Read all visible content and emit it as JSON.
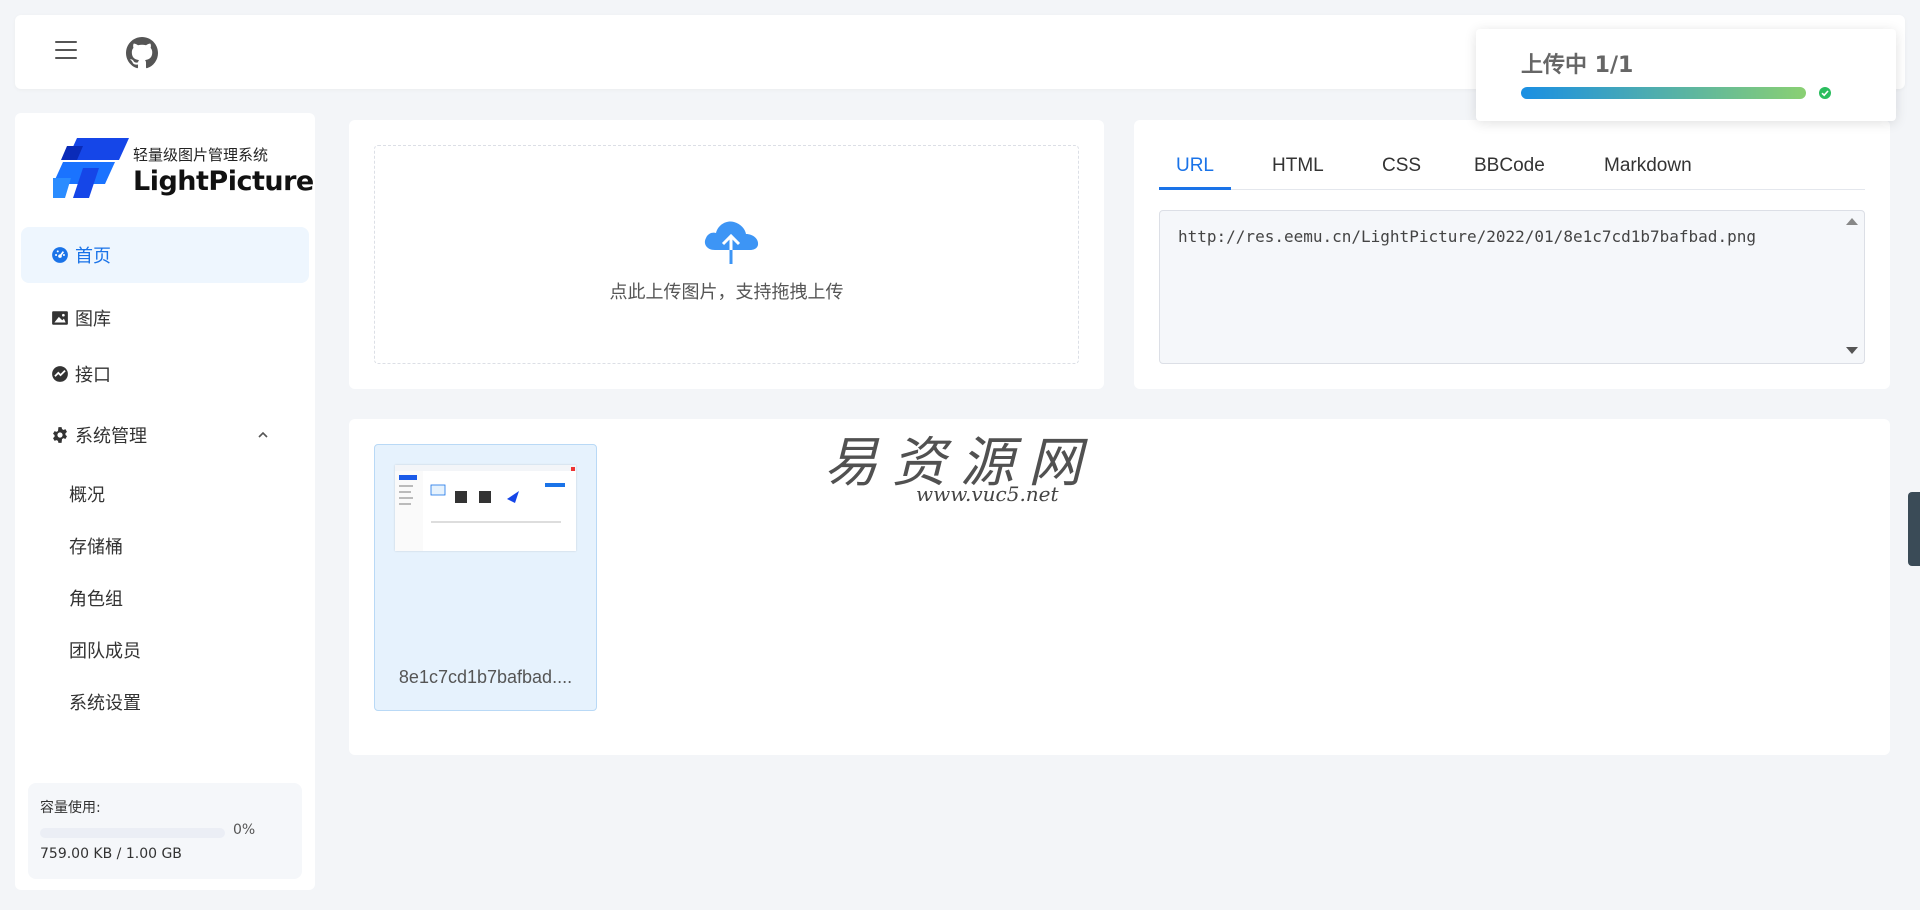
{
  "header": {
    "menu_icon": "hamburger-menu-icon",
    "github_icon": "github-icon"
  },
  "sidebar": {
    "logo": {
      "subtitle": "轻量级图片管理系统",
      "title": "LightPicture"
    },
    "items": [
      {
        "label": "首页",
        "icon": "dashboard-icon",
        "active": true
      },
      {
        "label": "图库",
        "icon": "image-icon",
        "active": false
      },
      {
        "label": "接口",
        "icon": "api-icon",
        "active": false
      },
      {
        "label": "系统管理",
        "icon": "gear-icon",
        "active": false,
        "expanded": true
      }
    ],
    "subitems": [
      "概况",
      "存储桶",
      "角色组",
      "团队成员",
      "系统设置"
    ],
    "usage": {
      "label": "容量使用:",
      "percent_text": "0%",
      "percent": 0,
      "size_text": "759.00 KB / 1.00 GB"
    }
  },
  "upload": {
    "hint": "点此上传图片，支持拖拽上传",
    "icon": "cloud-upload-icon"
  },
  "links": {
    "tabs": [
      "URL",
      "HTML",
      "CSS",
      "BBCode",
      "Markdown"
    ],
    "active_tab": 0,
    "value": "http://res.eemu.cn/LightPicture/2022/01/8e1c7cd1b7bafbad.png"
  },
  "gallery": {
    "items": [
      {
        "name": "8e1c7cd1b7bafbad...."
      }
    ]
  },
  "watermark": {
    "title": "易资源网",
    "url": "www.vuc5.net"
  },
  "upload_popup": {
    "title": "上传中 1/1",
    "progress": 1.0,
    "status_icon": "check-circle-icon"
  },
  "colors": {
    "accent": "#1a73e8",
    "background": "#f3f5f8",
    "success": "#2bbd5e"
  }
}
